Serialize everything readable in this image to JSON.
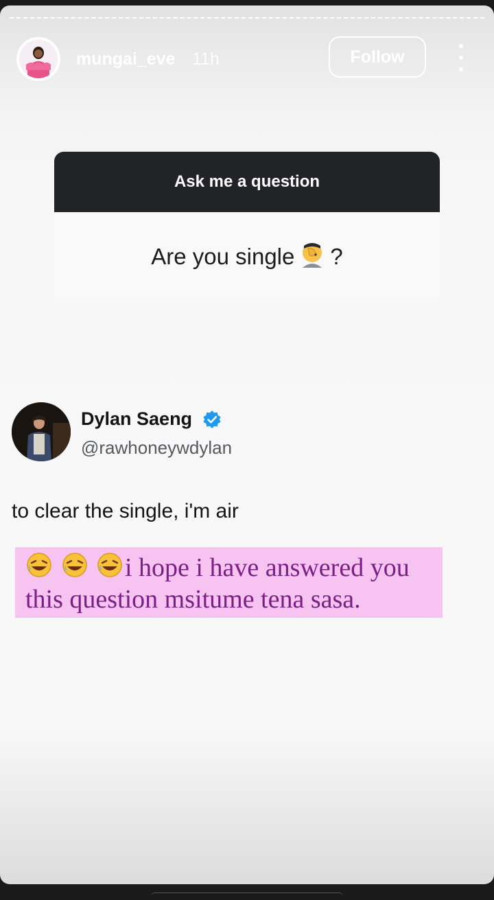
{
  "header": {
    "username": "mungai_eve",
    "time": "11h",
    "follow_label": "Follow",
    "more_icon": "more-vertical-icon"
  },
  "question_sticker": {
    "title": "Ask me a question",
    "question_text": "Are you single",
    "question_emoji": "face-palm",
    "question_end": "?"
  },
  "tweet": {
    "name": "Dylan Saeng",
    "verified": true,
    "handle": "@rawhoneywdylan",
    "text": "to clear the single, i'm air"
  },
  "caption": {
    "emojis": "rolling-on-the-floor-laughing x3",
    "line1": "i hope i have answered you",
    "line2": "this question msitume tena sasa."
  },
  "colors": {
    "question_header": "#222327",
    "caption_bg": "#f7c4f2",
    "caption_text": "#7a1f86",
    "verified_badge": "#1d9bf0"
  }
}
